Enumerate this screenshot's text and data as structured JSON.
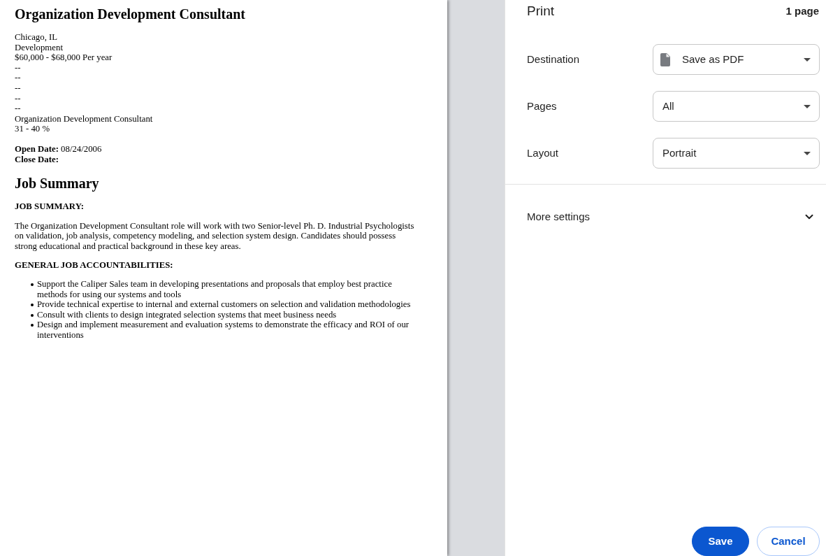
{
  "document": {
    "title": "Organization Development Consultant",
    "details": [
      "Chicago, IL",
      "Development",
      "$60,000 - $68,000 Per year",
      "--",
      "--",
      "--",
      "--",
      "--",
      "Organization Development Consultant",
      "31 - 40 %"
    ],
    "dates": [
      {
        "label": "Open Date:",
        "value": "08/24/2006"
      },
      {
        "label": "Close Date:"
      }
    ],
    "heading": "Job Summary",
    "summary_label": "JOB SUMMARY:",
    "summary": "The Organization Development Consultant role will work with two Senior-level Ph. D. Industrial Psychologists on validation, job analysis, competency modeling, and selection system design. Candidates should possess strong educational and practical background in these key areas.",
    "accountabilities_label": "GENERAL JOB ACCOUNTABILITIES:",
    "accountabilities": [
      "Support the Caliper Sales team in developing presentations and proposals that employ best practice methods for using our systems and tools",
      "Provide technical expertise to internal and external customers on selection and validation methodologies",
      "Consult with clients to design integrated selection systems that meet business needs",
      "Design and implement measurement and evaluation systems to demonstrate the efficacy and ROI of our interventions"
    ]
  },
  "print_panel": {
    "title": "Print",
    "page_count": "1 page",
    "settings": [
      {
        "label": "Destination",
        "value": "Save as PDF",
        "kind": "destination"
      },
      {
        "label": "Pages",
        "value": "All",
        "kind": "select"
      },
      {
        "label": "Layout",
        "value": "Portrait",
        "kind": "select"
      }
    ],
    "more_settings": {
      "label": "More settings",
      "expanded": false
    },
    "buttons": [
      {
        "label": "Save",
        "kind": "primary"
      },
      {
        "label": "Cancel",
        "kind": "secondary"
      }
    ]
  }
}
